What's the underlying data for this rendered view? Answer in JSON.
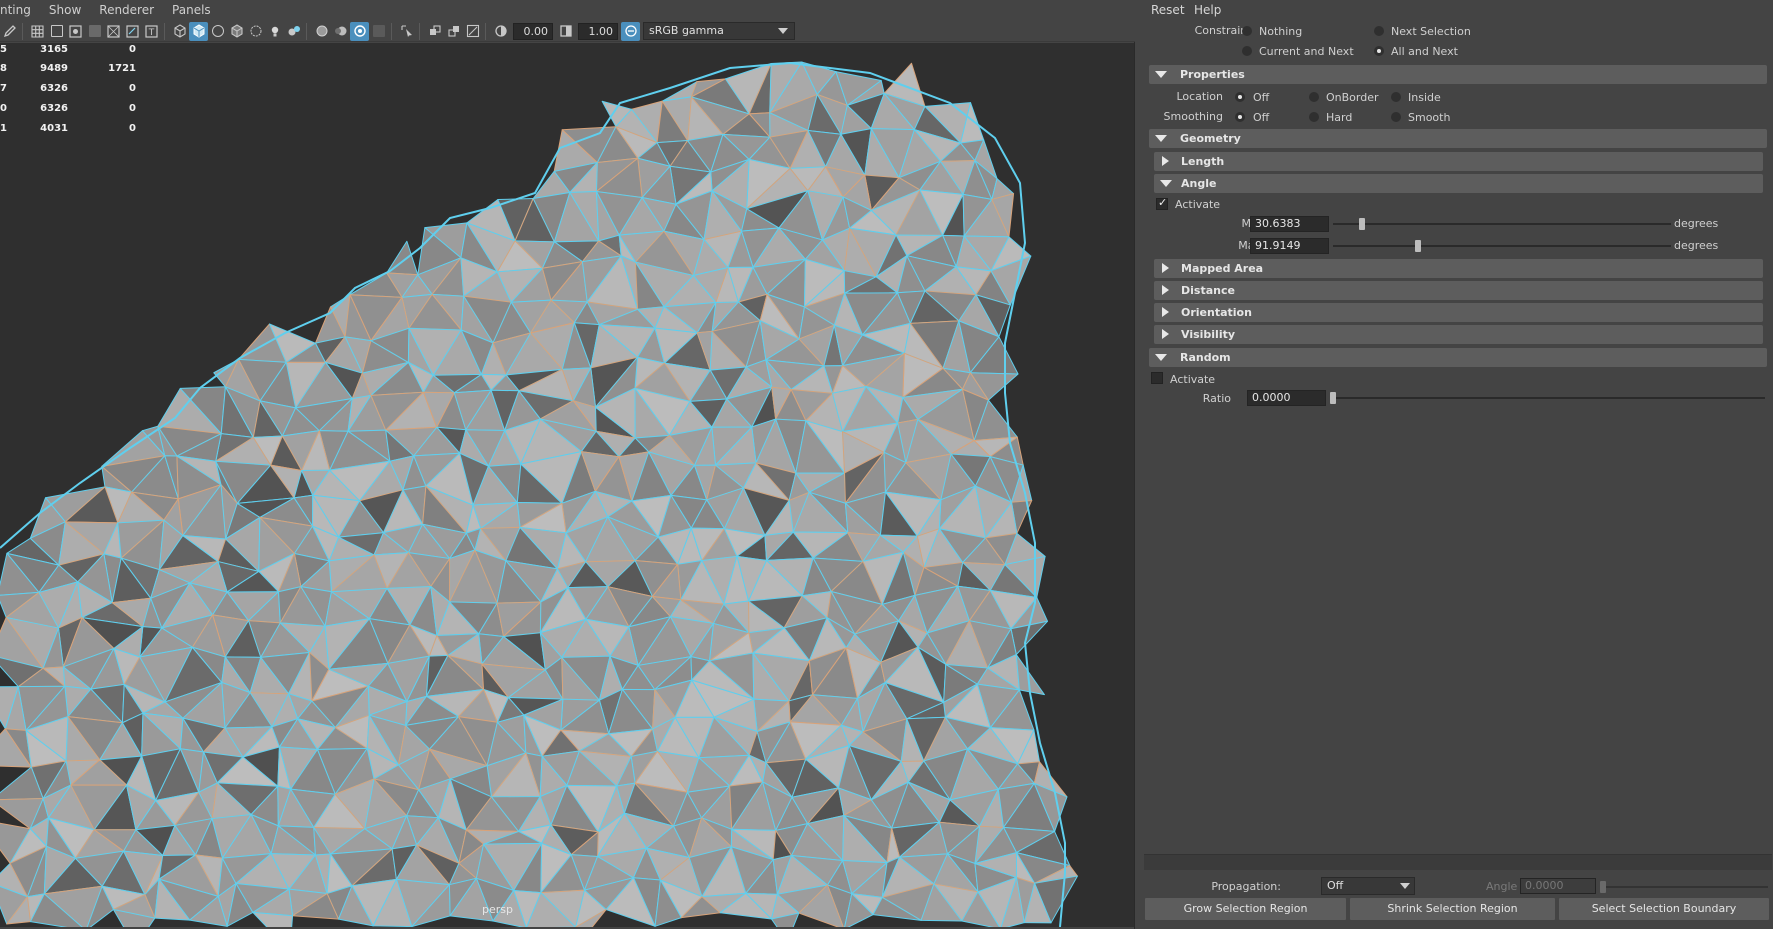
{
  "viewport": {
    "menus": [
      "nting",
      "Show",
      "Renderer",
      "Panels"
    ],
    "toolbar": {
      "exposure_value": "0.00",
      "gamma_value": "1.00",
      "color_space": "sRGB gamma"
    },
    "hud": [
      {
        "c0": "5",
        "c1": "3165",
        "c2": "0"
      },
      {
        "c0": "8",
        "c1": "9489",
        "c2": "1721"
      },
      {
        "c0": "7",
        "c1": "6326",
        "c2": "0"
      },
      {
        "c0": "0",
        "c1": "6326",
        "c2": "0"
      },
      {
        "c0": "1",
        "c1": "4031",
        "c2": "0"
      }
    ],
    "camera_label": "persp",
    "colors": {
      "wire": "#5fcfee",
      "mesh": "#a9a9a9",
      "edge_orange": "#d8a37a"
    }
  },
  "panel": {
    "menus": {
      "reset": "Reset",
      "help": "Help"
    },
    "constrain": {
      "label": "Constrain:",
      "options": [
        "Nothing",
        "Next Selection",
        "Current and Next",
        "All and Next"
      ],
      "selected": "All and Next"
    },
    "properties": {
      "title": "Properties",
      "location": {
        "label": "Location",
        "options": [
          "Off",
          "OnBorder",
          "Inside"
        ],
        "selected": "Off"
      },
      "smoothing": {
        "label": "Smoothing",
        "options": [
          "Off",
          "Hard",
          "Smooth"
        ],
        "selected": "Off"
      }
    },
    "geometry": {
      "title": "Geometry",
      "length": "Length",
      "angle": {
        "title": "Angle",
        "activate_label": "Activate",
        "activate_checked": true,
        "min_label": "Min",
        "min_value": "30.6383",
        "max_label": "Max",
        "max_value": "91.9149",
        "unit": "degrees"
      },
      "mapped_area": "Mapped Area",
      "distance": "Distance",
      "orientation": "Orientation",
      "visibility": "Visibility"
    },
    "random": {
      "title": "Random",
      "activate_label": "Activate",
      "activate_checked": false,
      "ratio_label": "Ratio",
      "ratio_value": "0.0000"
    },
    "footer": {
      "propagation_label": "Propagation:",
      "propagation_value": "Off",
      "angle_label": "Angle",
      "angle_value": "0.0000",
      "grow_button": "Grow Selection Region",
      "shrink_button": "Shrink Selection Region",
      "boundary_button": "Select Selection Boundary"
    }
  }
}
